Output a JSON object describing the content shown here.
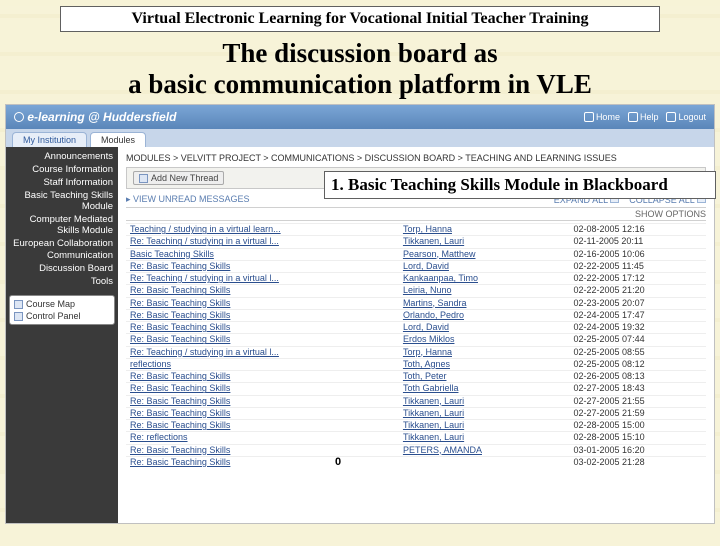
{
  "banner": "Virtual Electronic Learning for Vocational Initial Teacher Training",
  "slide_title_l1": "The discussion board as",
  "slide_title_l2": "a basic communication platform in VLE",
  "overlay": "1. Basic Teaching Skills Module in Blackboard",
  "version": "0",
  "header": {
    "brand": "e-learning @ Huddersfield",
    "home": "Home",
    "help": "Help",
    "logout": "Logout"
  },
  "tabs": {
    "t1": "My Institution",
    "t2": "Modules"
  },
  "sidebar": {
    "items": [
      "Announcements",
      "Course Information",
      "Staff Information",
      "Basic Teaching Skills Module",
      "Computer Mediated Skills Module",
      "European Collaboration",
      "Communication",
      "Discussion Board",
      "Tools"
    ],
    "tools": {
      "map": "Course Map",
      "cp": "Control Panel"
    }
  },
  "crumbs": "MODULES > VELVITT PROJECT > COMMUNICATIONS > DISCUSSION BOARD > TEACHING AND LEARNING ISSUES",
  "toolbar": {
    "add": "Add New Thread"
  },
  "subbar": {
    "view": "VIEW UNREAD MESSAGES",
    "expand": "EXPAND ALL",
    "collapse": "COLLAPSE ALL"
  },
  "opts": "SHOW OPTIONS",
  "rows": [
    {
      "t": "Teaching / studying in a virtual learn...",
      "a": "Torp, Hanna",
      "d": "02-08-2005 12:16"
    },
    {
      "t": "Re: Teaching / studying in a virtual l...",
      "a": "Tikkanen, Lauri",
      "d": "02-11-2005 20:11"
    },
    {
      "t": "Basic Teaching Skills",
      "a": "Pearson, Matthew",
      "d": "02-16-2005 10:06"
    },
    {
      "t": "Re: Basic Teaching Skills",
      "a": "Lord, David",
      "d": "02-22-2005 11:45"
    },
    {
      "t": "Re: Teaching / studying in a virtual l...",
      "a": "Kankaanpaa, Timo",
      "d": "02-22-2005 17:12"
    },
    {
      "t": "Re: Basic Teaching Skills",
      "a": "Leiria, Nuno",
      "d": "02-22-2005 21:20"
    },
    {
      "t": "Re: Basic Teaching Skills",
      "a": "Martins, Sandra",
      "d": "02-23-2005 20:07"
    },
    {
      "t": "Re: Basic Teaching Skills",
      "a": "Orlando, Pedro",
      "d": "02-24-2005 17:47"
    },
    {
      "t": "Re: Basic Teaching Skills",
      "a": "Lord, David",
      "d": "02-24-2005 19:32"
    },
    {
      "t": "Re: Basic Teaching Skills",
      "a": "Erdos Miklos",
      "d": "02-25-2005 07:44"
    },
    {
      "t": "Re: Teaching / studying in a virtual l...",
      "a": "Torp, Hanna",
      "d": "02-25-2005 08:55"
    },
    {
      "t": "reflections",
      "a": "Toth, Agnes",
      "d": "02-25-2005 08:12"
    },
    {
      "t": "Re: Basic Teaching Skills",
      "a": "Toth, Peter",
      "d": "02-26-2005 08:13"
    },
    {
      "t": "Re: Basic Teaching Skills",
      "a": "Toth Gabriella",
      "d": "02-27-2005 18:43"
    },
    {
      "t": "Re: Basic Teaching Skills",
      "a": "Tikkanen, Lauri",
      "d": "02-27-2005 21:55"
    },
    {
      "t": "Re: Basic Teaching Skills",
      "a": "Tikkanen, Lauri",
      "d": "02-27-2005 21:59"
    },
    {
      "t": "Re: Basic Teaching Skills",
      "a": "Tikkanen, Lauri",
      "d": "02-28-2005 15:00"
    },
    {
      "t": "Re: reflections",
      "a": "Tikkanen, Lauri",
      "d": "02-28-2005 15:10"
    },
    {
      "t": "Re: Basic Teaching Skills",
      "a": "PETERS, AMANDA",
      "d": "03-01-2005 16:20"
    },
    {
      "t": "Re: Basic Teaching Skills",
      "a": "",
      "d": "03-02-2005 21:28"
    }
  ]
}
